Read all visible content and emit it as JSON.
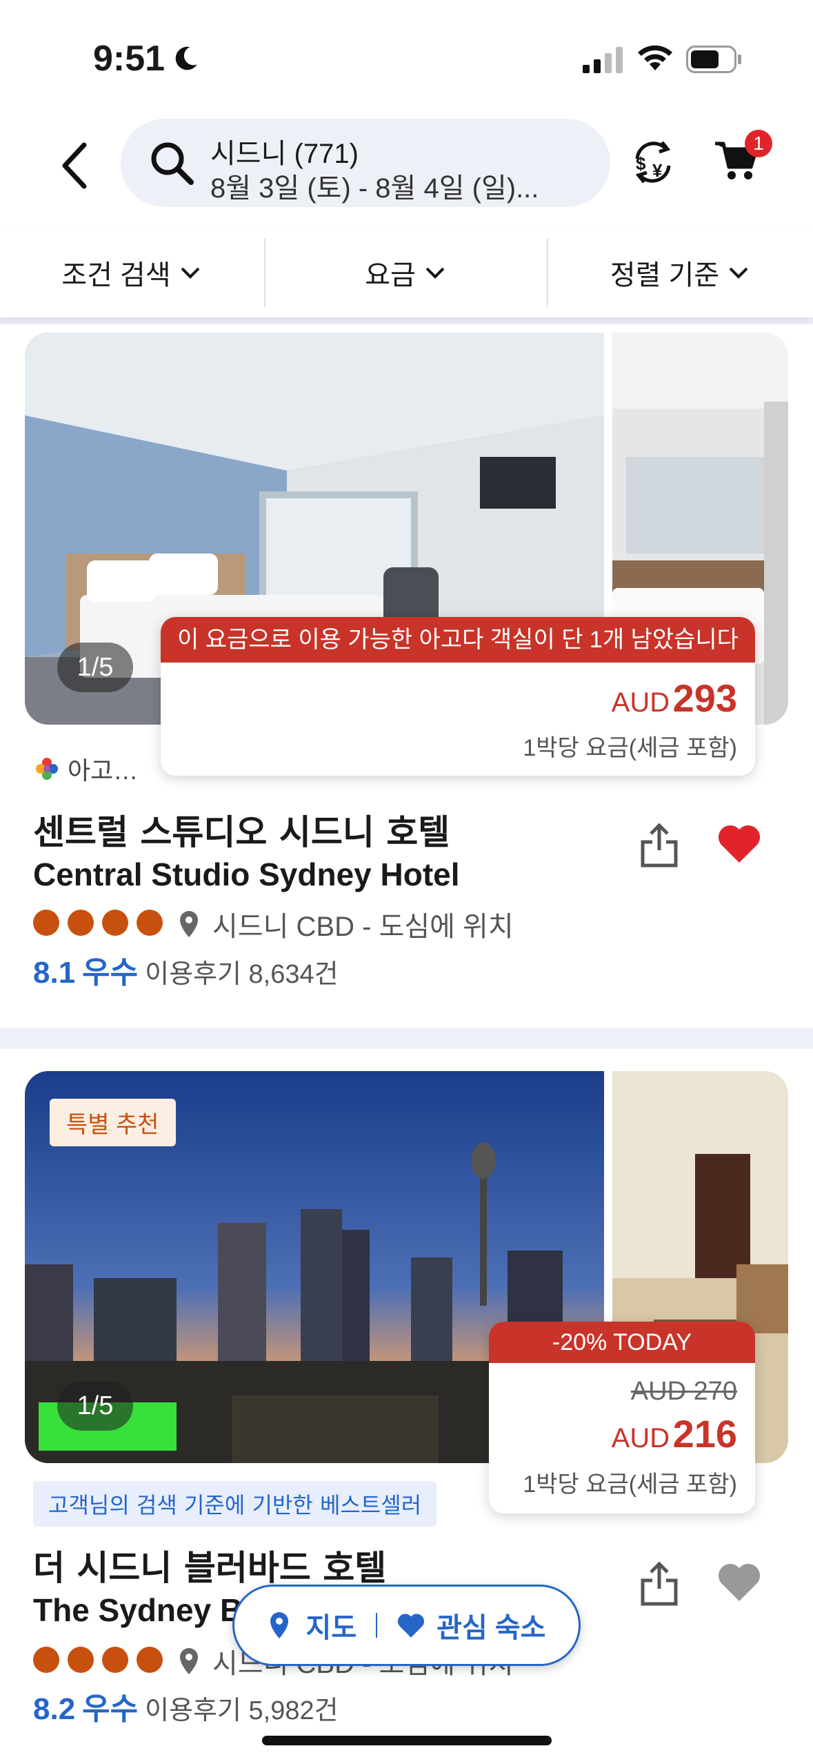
{
  "status": {
    "time": "9:51"
  },
  "search": {
    "title": "시드니 (771)",
    "dates": "8월 3일 (토) - 8월 4일 (일)..."
  },
  "cart": {
    "count": "1"
  },
  "filters": [
    {
      "label": "조건 검색"
    },
    {
      "label": "요금"
    },
    {
      "label": "정렬 기준"
    }
  ],
  "hotels": [
    {
      "photo_counter": "1/5",
      "banner": "이 요금으로 이용 가능한 아고다 객실이 단 1개 남았습니다",
      "currency": "AUD",
      "price": "293",
      "per_night": "1박당 요금(세금 포함)",
      "source": "아고…",
      "name_ko": "센트럴 스튜디오 시드니 호텔",
      "name_en": "Central Studio Sydney Hotel",
      "stars": 4,
      "location": "시드니 CBD - 도심에 위치",
      "score": "8.1",
      "score_label": "우수",
      "reviews": "이용후기 8,634건",
      "favorited": true
    },
    {
      "tag": "특별 추천",
      "photo_counter": "1/5",
      "banner": "-20% TODAY",
      "old_price": "AUD 270",
      "currency": "AUD",
      "price": "216",
      "per_night": "1박당 요금(세금 포함)",
      "bestseller": "고객님의 검색 기준에 기반한 베스트셀러",
      "name_ko": "더 시드니 블러바드 호텔",
      "name_en": "The Sydney Boulevard Hotel",
      "stars": 4,
      "location": "시드니 CBD - 도심에 위치",
      "score": "8.2",
      "score_label": "우수",
      "reviews": "이용후기 5,982건",
      "favorited": false
    }
  ],
  "floating": {
    "map": "지도",
    "favorites": "관심 숙소"
  },
  "colors": {
    "brand_blue": "#2566c8",
    "price_red": "#c8342a",
    "star_orange": "#c8500e"
  }
}
